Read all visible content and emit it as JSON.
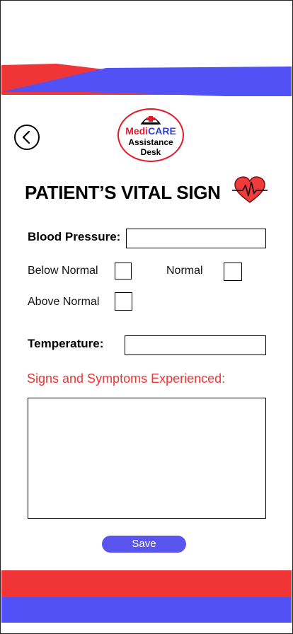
{
  "colors": {
    "red": "#ef3536",
    "blue": "#5151f5",
    "save": "#5b55f0"
  },
  "logo": {
    "brand_part1": "Medi",
    "brand_part2": "CARE",
    "line2": "Assistance",
    "line3": "Desk"
  },
  "header": {
    "title": "PATIENT’S VITAL SIGN"
  },
  "form": {
    "blood_pressure_label": "Blood Pressure:",
    "below_normal_label": "Below Normal",
    "normal_label": "Normal",
    "above_normal_label": "Above Normal",
    "temperature_label": "Temperature:",
    "symptoms_label": "Signs and Symptoms Experienced:",
    "save_label": "Save"
  },
  "icons": {
    "back": "back-arrow-icon",
    "heart": "heart-pulse-icon",
    "nurse": "nurse-cap-icon"
  }
}
